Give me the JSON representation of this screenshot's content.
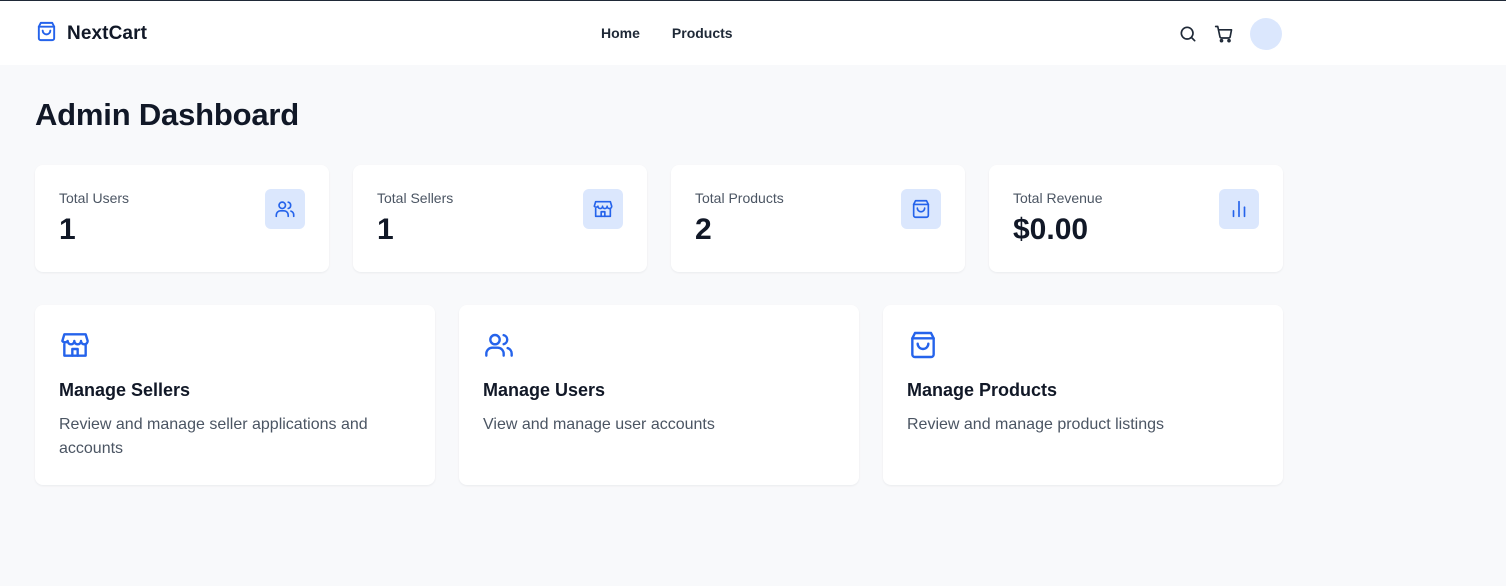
{
  "header": {
    "brand": "NextCart",
    "nav": [
      "Home",
      "Products"
    ],
    "icons": {
      "logo": "shopping-bag-icon",
      "search": "search-icon",
      "cart": "cart-icon"
    }
  },
  "page": {
    "title": "Admin Dashboard"
  },
  "stats": [
    {
      "label": "Total Users",
      "value": "1",
      "icon": "users-icon"
    },
    {
      "label": "Total Sellers",
      "value": "1",
      "icon": "store-icon"
    },
    {
      "label": "Total Products",
      "value": "2",
      "icon": "shopping-bag-icon"
    },
    {
      "label": "Total Revenue",
      "value": "$0.00",
      "icon": "bar-chart-icon"
    }
  ],
  "manage": [
    {
      "title": "Manage Sellers",
      "description": "Review and manage seller applications and accounts",
      "icon": "store-icon"
    },
    {
      "title": "Manage Users",
      "description": "View and manage user accounts",
      "icon": "users-icon"
    },
    {
      "title": "Manage Products",
      "description": "Review and manage product listings",
      "icon": "shopping-bag-icon"
    }
  ],
  "colors": {
    "accent": "#2563eb",
    "accent_soft": "#dbe7fd",
    "background": "#f8f9fb",
    "card": "#ffffff",
    "text": "#111827",
    "muted": "#4b5563"
  }
}
